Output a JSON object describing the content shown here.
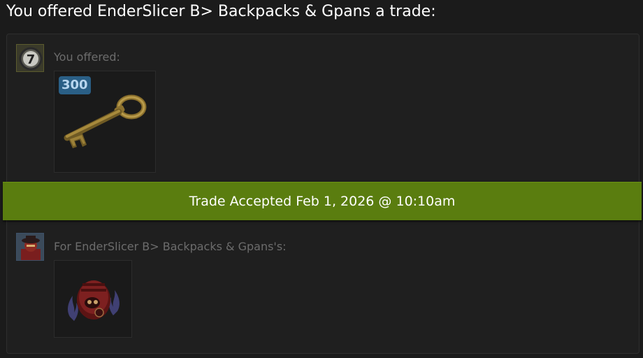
{
  "heading": "You offered EnderSlicer B> Backpacks & Gpans a trade:",
  "your_offer": {
    "label": "You offered:",
    "items": [
      {
        "name": "Mann Co. Supply Crate Key",
        "quantity": "300",
        "icon": "key-icon"
      }
    ]
  },
  "status": {
    "text": "Trade Accepted Feb 1, 2026 @ 10:10am",
    "color": "#5a7d0f"
  },
  "their_offer": {
    "label": "For EnderSlicer B> Backpacks & Gpans's:",
    "items": [
      {
        "name": "Hat",
        "icon": "hat-icon"
      }
    ]
  }
}
